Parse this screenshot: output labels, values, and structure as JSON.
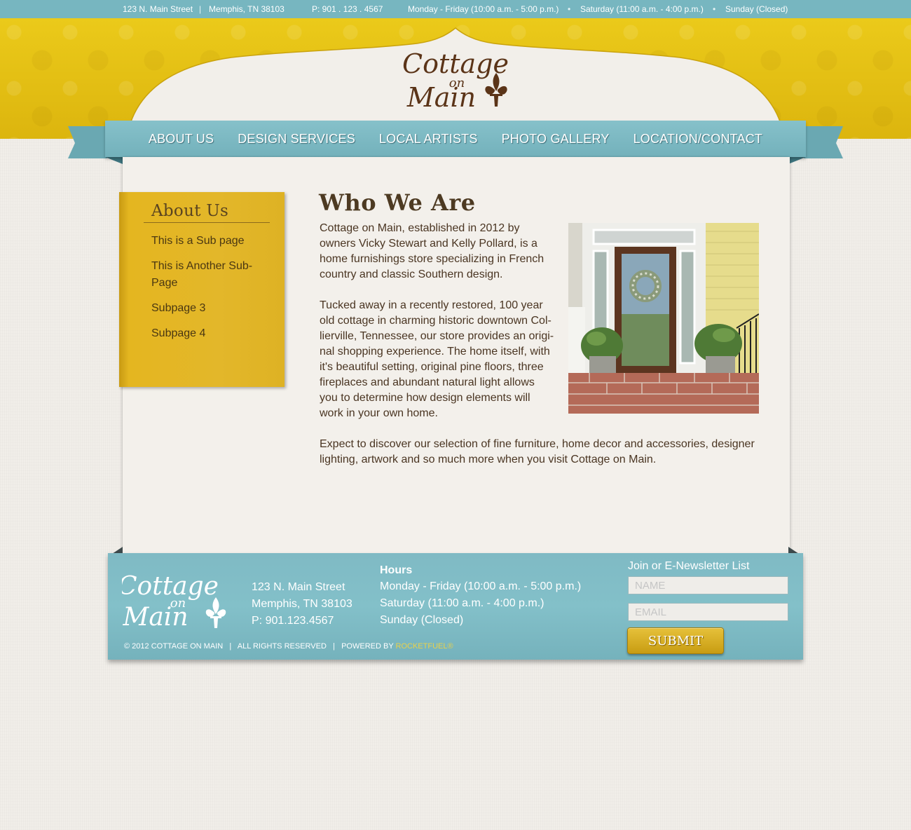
{
  "topbar": {
    "address": "123 N. Main Street",
    "city": "Memphis, TN 38103",
    "phone": "P: 901 . 123 . 4567",
    "hours_weekday": "Monday - Friday (10:00 a.m. - 5:00 p.m.)",
    "hours_saturday": "Saturday (11:00 a.m. - 4:00 p.m.)",
    "hours_sunday": "Sunday (Closed)",
    "separator_pipe": "|",
    "separator_dot": "•"
  },
  "logo": {
    "line1": "Cottage",
    "line2": "on",
    "line3": "Main"
  },
  "nav": {
    "items": [
      {
        "label": "ABOUT US"
      },
      {
        "label": "DESIGN SERVICES"
      },
      {
        "label": "LOCAL ARTISTS"
      },
      {
        "label": "PHOTO GALLERY"
      },
      {
        "label": "LOCATION/CONTACT"
      }
    ]
  },
  "sidebar": {
    "title": "About Us",
    "links": [
      {
        "label": "This is a Sub page"
      },
      {
        "label": "This is Another Sub-Page"
      },
      {
        "label": "Subpage 3"
      },
      {
        "label": "Subpage 4"
      }
    ]
  },
  "article": {
    "title": "Who We Are",
    "para1_lines": [
      "Cottage on Main, established in 2012 by",
      "owners Vicky Stewart and Kelly Pollard, is a",
      "home furnishings store specializing in French",
      "country and classic Southern design."
    ],
    "para2_lines": [
      "Tucked away in a recently restored, 100 year",
      "old cottage in charming historic downtown Col-",
      "lierville, Tennessee, our store provides an origi-",
      "nal shopping experience.  The home itself, with",
      "it's beautiful setting, original pine floors, three",
      "fireplaces and abundant natural light allows",
      "you to determine how design elements will",
      "work in your own home."
    ],
    "para3_lines": [
      "Expect to discover our selection of fine furniture, home decor and accessories, designer",
      "lighting, artwork and so much more when you visit Cottage on Main."
    ]
  },
  "footer": {
    "address_lines": [
      "123 N. Main Street",
      "Memphis, TN 38103",
      "P: 901.123.4567"
    ],
    "hours_heading": "Hours",
    "hours_lines": [
      "Monday - Friday (10:00 a.m. - 5:00 p.m.)",
      "Saturday (11:00 a.m. - 4:00 p.m.)",
      "Sunday (Closed)"
    ],
    "copyright": "© 2012 COTTAGE ON MAIN   |   ALL RIGHTS RESERVED   |   POWERED BY ",
    "powered_by": "ROCKETFUEL®",
    "newsletter_title": "Join or E-Newsletter List",
    "name_placeholder": "NAME",
    "email_placeholder": "EMAIL",
    "submit_label": "SUBMIT"
  },
  "colors": {
    "topbar": "#77b6c0",
    "header_yellow": "#e2be12",
    "nav_blue": "#7ab8c2",
    "side_gold": "#e0b424",
    "text_brown": "#4a3522",
    "powered_by": "#e9d14a"
  }
}
